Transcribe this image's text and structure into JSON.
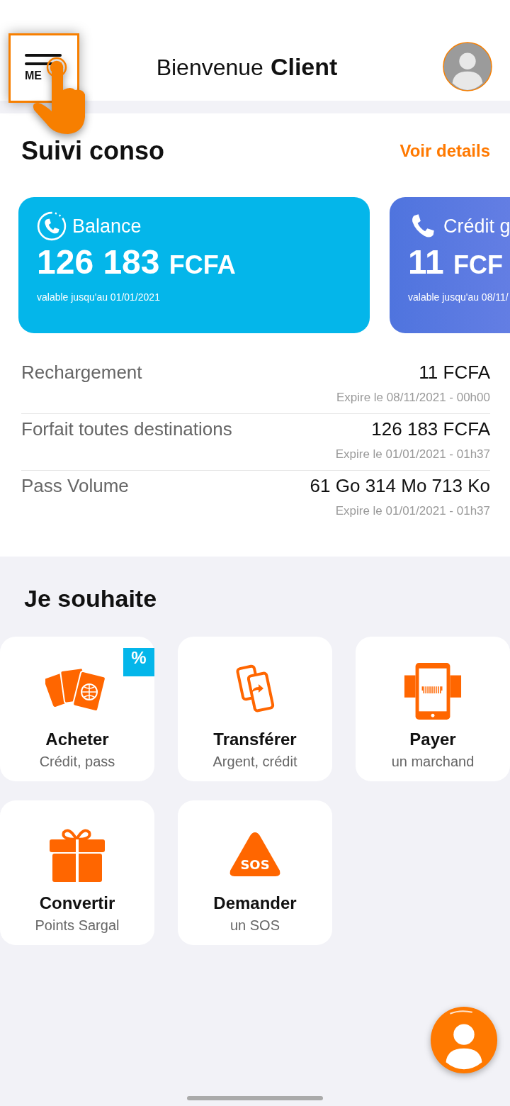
{
  "header": {
    "menu_label": "ME",
    "greeting": "Bienvenue",
    "name": "Client"
  },
  "usage": {
    "title": "Suivi conso",
    "link": "Voir details",
    "cards": [
      {
        "kind": "balance",
        "label": "Balance",
        "amount": "126 183",
        "unit": "FCFA",
        "validity": "valable jusqu'au 01/01/2021"
      },
      {
        "kind": "credit",
        "label": "Crédit g",
        "amount": "11",
        "unit": "FCF",
        "validity": "valable jusqu'au 08/11/"
      }
    ],
    "rows": [
      {
        "name": "Rechargement",
        "value": "11 FCFA",
        "expiry": "Expire le 08/11/2021 - 00h00"
      },
      {
        "name": "Forfait toutes destinations",
        "value": "126 183 FCFA",
        "expiry": "Expire le 01/01/2021 - 01h37"
      },
      {
        "name": "Pass Volume",
        "value": "61 Go 314 Mo 713 Ko",
        "expiry": "Expire le 01/01/2021 - 01h37"
      }
    ]
  },
  "actions": {
    "title": "Je souhaite",
    "tiles": [
      {
        "kind": "cards",
        "title": "Acheter",
        "subtitle": "Crédit, pass",
        "badge": "%"
      },
      {
        "kind": "transfer",
        "title": "Transférer",
        "subtitle": "Argent, crédit"
      },
      {
        "kind": "pay",
        "title": "Payer",
        "subtitle": "un marchand"
      },
      {
        "kind": "gift",
        "title": "Convertir",
        "subtitle": "Points Sargal"
      },
      {
        "kind": "sos",
        "title": "Demander",
        "subtitle": "un SOS",
        "icon_text": "SOS"
      }
    ]
  }
}
